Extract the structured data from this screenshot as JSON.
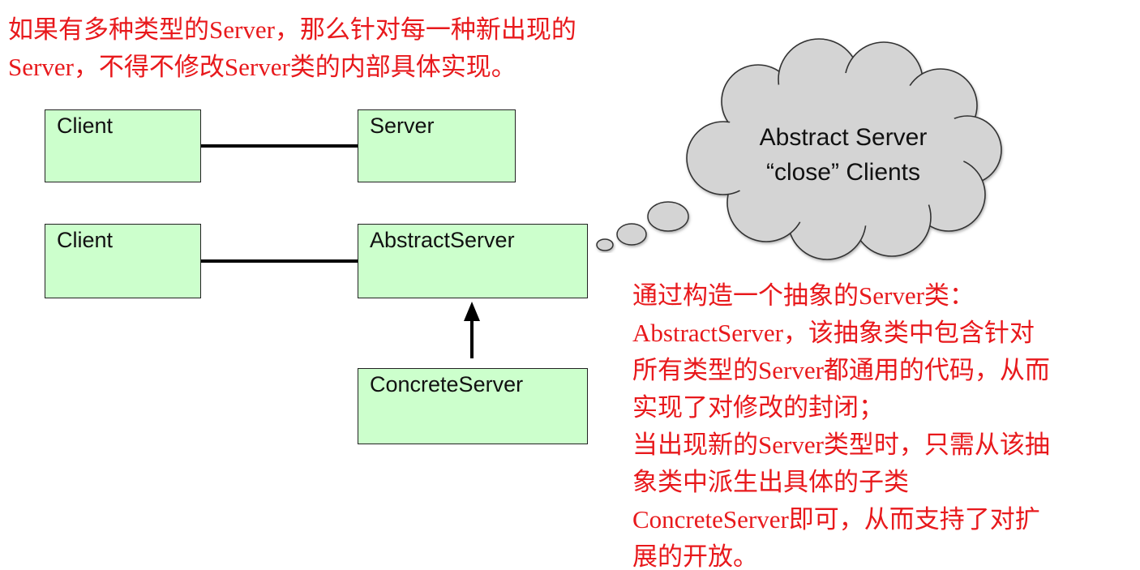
{
  "top_note": {
    "lines": [
      "如果有多种类型的Server，那么针对每一种新出现的",
      "Server，不得不修改Server类的内部具体实现。"
    ]
  },
  "diagram": {
    "row1": {
      "client_label": "Client",
      "server_label": "Server"
    },
    "row2": {
      "client_label": "Client",
      "abstract_server_label": "AbstractServer",
      "concrete_server_label": "ConcreteServer"
    }
  },
  "cloud": {
    "lines": [
      "Abstract Server",
      "“close” Clients"
    ]
  },
  "side_note": {
    "lines": [
      "通过构造一个抽象的Server类：",
      "AbstractServer，该抽象类中包含针对",
      "所有类型的Server都通用的代码，从而",
      "实现了对修改的封闭；",
      "当出现新的Server类型时，只需从该抽",
      "象类中派生出具体的子类",
      "ConcreteServer即可，从而支持了对扩",
      "展的开放。"
    ]
  },
  "colors": {
    "note_text": "#e8191c",
    "box_fill": "#ccffcc",
    "cloud_fill": "#d4d4d4"
  }
}
